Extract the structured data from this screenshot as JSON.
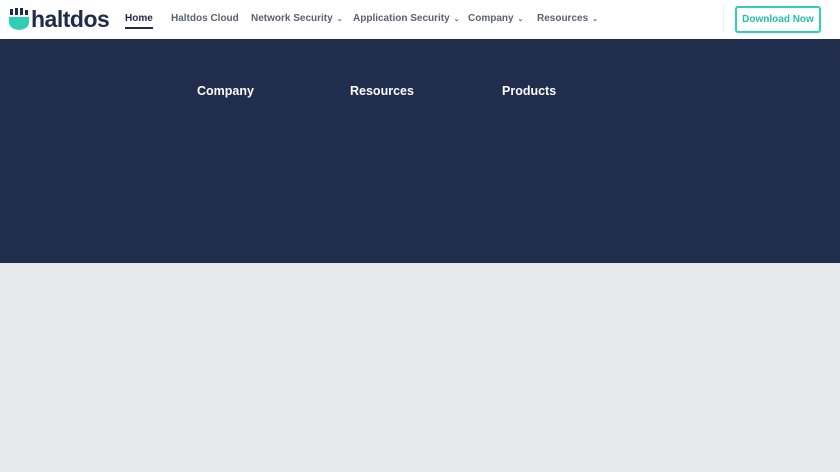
{
  "brand": {
    "name": "haltdos"
  },
  "nav": {
    "items": [
      {
        "label": "Home"
      },
      {
        "label": "Haltdos Cloud"
      },
      {
        "label": "Network Security"
      },
      {
        "label": "Application Security"
      },
      {
        "label": "Company"
      },
      {
        "label": "Resources"
      }
    ],
    "chevron": "⌄",
    "download_label": "Download Now"
  },
  "footer": {
    "headings": [
      "Company",
      "Resources",
      "Products"
    ]
  },
  "colors": {
    "navy": "#212d4d",
    "accent": "#2ecfb5"
  }
}
